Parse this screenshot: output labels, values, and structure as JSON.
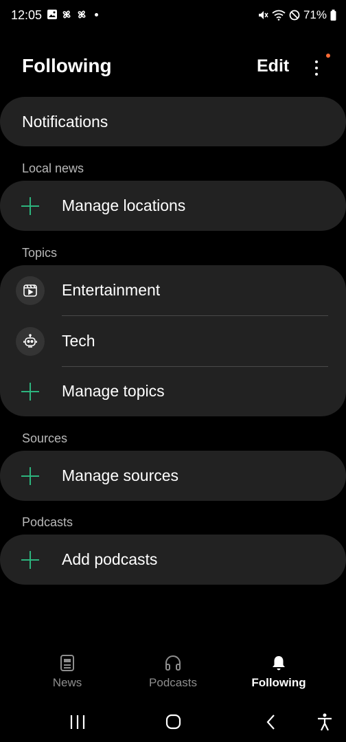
{
  "status_bar": {
    "time": "12:05",
    "battery": "71%",
    "left_icons": [
      "image-icon",
      "pinwheel-icon",
      "pinwheel-icon",
      "dot"
    ],
    "right_icons": [
      "mute-icon",
      "wifi-icon",
      "dnd-icon",
      "battery-icon"
    ]
  },
  "header": {
    "title": "Following",
    "edit_label": "Edit",
    "more_icon": "more-vertical-icon",
    "badge_color": "#ff6b35"
  },
  "notifications": {
    "label": "Notifications"
  },
  "sections": {
    "local_news": {
      "heading": "Local news",
      "items": [
        {
          "label": "Manage locations",
          "icon": "plus-icon"
        }
      ]
    },
    "topics": {
      "heading": "Topics",
      "items": [
        {
          "label": "Entertainment",
          "icon": "play-video-icon"
        },
        {
          "label": "Tech",
          "icon": "robot-icon"
        },
        {
          "label": "Manage topics",
          "icon": "plus-icon"
        }
      ]
    },
    "sources": {
      "heading": "Sources",
      "items": [
        {
          "label": "Manage sources",
          "icon": "plus-icon"
        }
      ]
    },
    "podcasts": {
      "heading": "Podcasts",
      "items": [
        {
          "label": "Add podcasts",
          "icon": "plus-icon"
        }
      ]
    }
  },
  "bottom_nav": {
    "items": [
      {
        "label": "News",
        "icon": "newspaper-icon",
        "active": false
      },
      {
        "label": "Podcasts",
        "icon": "headphones-icon",
        "active": false
      },
      {
        "label": "Following",
        "icon": "bell-icon",
        "active": true
      }
    ]
  },
  "system_nav": [
    "recents-button",
    "home-button",
    "back-button",
    "accessibility-button"
  ],
  "colors": {
    "background": "#000000",
    "card": "#222222",
    "accent_plus": "#2db57e",
    "section_label": "#b9b9b9"
  }
}
